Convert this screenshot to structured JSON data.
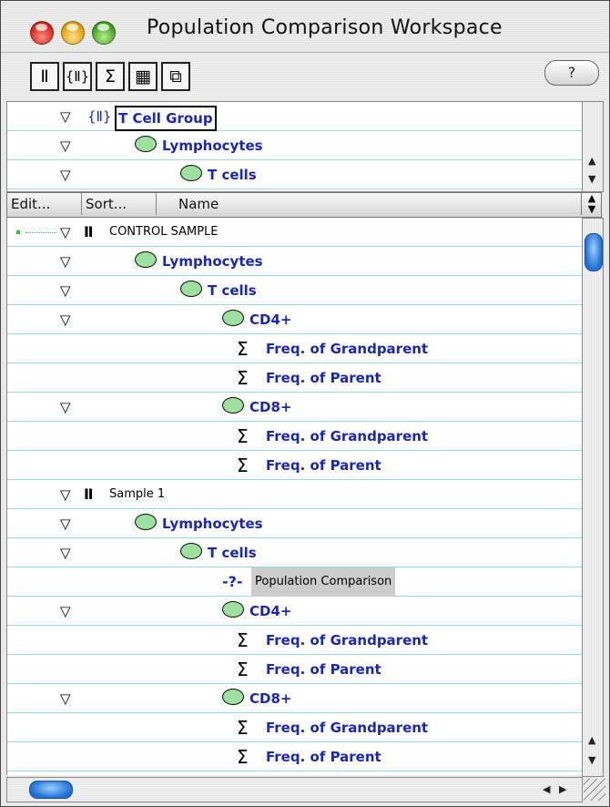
{
  "window": {
    "title": "Population Comparison Workspace"
  },
  "toolbar": {
    "buttons": [
      {
        "name": "sample-tube",
        "glyph": "Ⅱ"
      },
      {
        "name": "group",
        "glyph": "{Ⅱ}"
      },
      {
        "name": "statistic",
        "glyph": "Σ"
      },
      {
        "name": "table",
        "glyph": "▦"
      },
      {
        "name": "layout",
        "glyph": "⧉"
      }
    ],
    "help_label": "?"
  },
  "groups_pane": {
    "rows": [
      {
        "label": "T Cell Group",
        "type": "group",
        "level": 0
      },
      {
        "label": "Lymphocytes",
        "type": "population",
        "level": 1
      },
      {
        "label": "T cells",
        "type": "population",
        "level": 2
      }
    ]
  },
  "column_header": {
    "edit_label": "Edit...",
    "sort_label": "Sort...",
    "name_label": "Name"
  },
  "samples_pane": {
    "rows": [
      {
        "label": "CONTROL SAMPLE",
        "type": "sample",
        "level": 0,
        "expanded": true
      },
      {
        "label": "Lymphocytes",
        "type": "population",
        "level": 1,
        "expanded": true
      },
      {
        "label": "T cells",
        "type": "population",
        "level": 2,
        "expanded": true
      },
      {
        "label": "CD4+",
        "type": "population",
        "level": 3,
        "expanded": true
      },
      {
        "label": "Freq. of Grandparent",
        "type": "statistic",
        "level": 4
      },
      {
        "label": "Freq. of Parent",
        "type": "statistic",
        "level": 4
      },
      {
        "label": "CD8+",
        "type": "population",
        "level": 3,
        "expanded": true
      },
      {
        "label": "Freq. of Grandparent",
        "type": "statistic",
        "level": 4
      },
      {
        "label": "Freq. of Parent",
        "type": "statistic",
        "level": 4
      },
      {
        "label": "Sample 1",
        "type": "sample",
        "level": 0,
        "expanded": true
      },
      {
        "label": "Lymphocytes",
        "type": "population",
        "level": 1,
        "expanded": true
      },
      {
        "label": "T cells",
        "type": "population",
        "level": 2,
        "expanded": true
      },
      {
        "label": "Population Comparison",
        "type": "comparison",
        "level": 3,
        "highlighted": true
      },
      {
        "label": "CD4+",
        "type": "population",
        "level": 3,
        "expanded": true
      },
      {
        "label": "Freq. of Grandparent",
        "type": "statistic",
        "level": 4
      },
      {
        "label": "Freq. of Parent",
        "type": "statistic",
        "level": 4
      },
      {
        "label": "CD8+",
        "type": "population",
        "level": 3,
        "expanded": true
      },
      {
        "label": "Freq. of Grandparent",
        "type": "statistic",
        "level": 4
      },
      {
        "label": "Freq. of Parent",
        "type": "statistic",
        "level": 4
      }
    ]
  },
  "icons": {
    "tube": "Ⅱ",
    "population": "cell-icon",
    "statistic": "Σ",
    "comparison": "-?-",
    "triangle": "▽"
  },
  "colors": {
    "population_text": "#1c26b8",
    "row_divider": "#9fd9e3",
    "scroll_thumb": "#1f6ed4"
  }
}
